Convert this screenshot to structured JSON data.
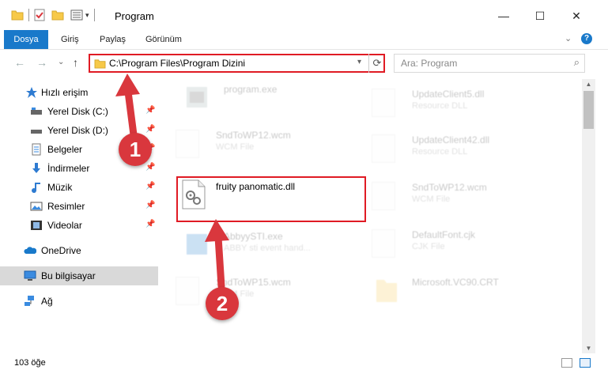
{
  "window": {
    "title": "Program",
    "minimize": "—",
    "maximize": "☐",
    "close": "✕"
  },
  "ribbon": {
    "tabs": [
      "Dosya",
      "Giriş",
      "Paylaş",
      "Görünüm"
    ],
    "help": "?",
    "collapse": "⌄"
  },
  "nav": {
    "back": "←",
    "forward": "→",
    "recent": "⌄",
    "up": "↑",
    "address": "C:\\Program Files\\Program Dizini",
    "search_placeholder": "Ara: Program"
  },
  "sidebar": {
    "items": [
      {
        "label": "Hızlı erişim",
        "icon": "star-icon",
        "pinned": false
      },
      {
        "label": "Yerel Disk (C:)",
        "icon": "drive-icon",
        "pinned": true
      },
      {
        "label": "Yerel Disk (D:)",
        "icon": "drive-icon",
        "pinned": true
      },
      {
        "label": "Belgeler",
        "icon": "documents-icon",
        "pinned": true
      },
      {
        "label": "İndirmeler",
        "icon": "download-icon",
        "pinned": true
      },
      {
        "label": "Müzik",
        "icon": "music-icon",
        "pinned": true
      },
      {
        "label": "Resimler",
        "icon": "pictures-icon",
        "pinned": true
      },
      {
        "label": "Videolar",
        "icon": "videos-icon",
        "pinned": true
      },
      {
        "label": "OneDrive",
        "icon": "cloud-icon",
        "pinned": false
      },
      {
        "label": "Bu bilgisayar",
        "icon": "computer-icon",
        "pinned": false
      },
      {
        "label": "Ağ",
        "icon": "network-icon",
        "pinned": false
      }
    ]
  },
  "files": {
    "left": [
      {
        "name": "program.exe",
        "type": ""
      },
      {
        "name": "SndToWP12.wcm",
        "type": "WCM File"
      },
      {
        "name": "fruity panomatic.dll",
        "type": ""
      },
      {
        "name": "AbbyySTI.exe",
        "type": "ABBY sti event hand..."
      },
      {
        "name": "SndToWP15.wcm",
        "type": "WCM File"
      }
    ],
    "right": [
      {
        "name": "UpdateClient5.dll",
        "type": "Resource DLL"
      },
      {
        "name": "UpdateClient42.dll",
        "type": "Resource DLL"
      },
      {
        "name": "SndToWP12.wcm",
        "type": "WCM File"
      },
      {
        "name": "DefaultFont.cjk",
        "type": "CJK File"
      },
      {
        "name": "Microsoft.VC90.CRT",
        "type": ""
      }
    ]
  },
  "status": {
    "count": "103 öğe"
  },
  "annotations": {
    "step1": "1",
    "step2": "2"
  },
  "colors": {
    "accent": "#1979ca",
    "annotation_red": "#d9373d",
    "highlight_border": "#e01b24",
    "folder_yellow": "#f7c948"
  }
}
